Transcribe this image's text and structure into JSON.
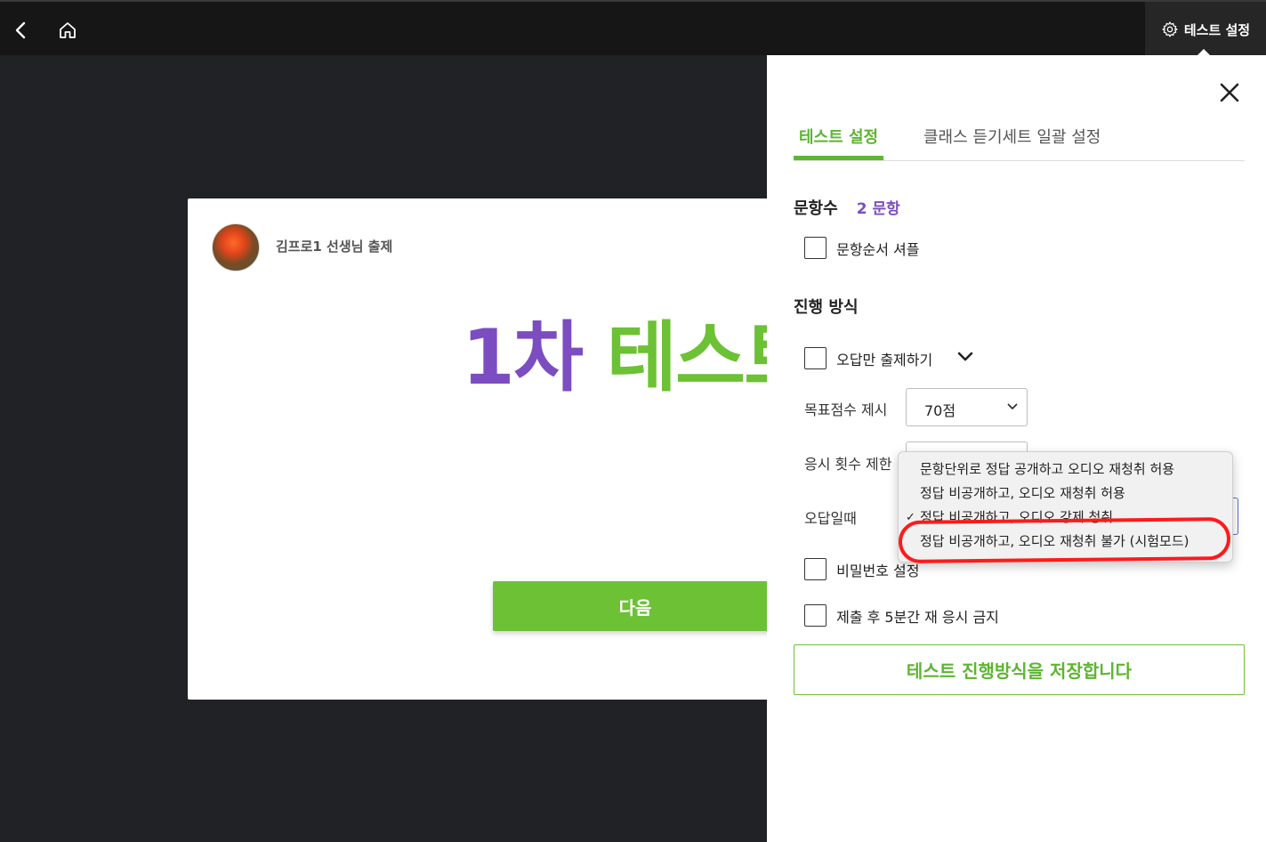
{
  "topbar": {
    "settings_label": "테스트 설정"
  },
  "card": {
    "author": "김프로1 선생님 출제",
    "title_number": "1차",
    "title_word": "테스트",
    "next_label": "다음"
  },
  "panel": {
    "tabs": [
      {
        "label": "테스트 설정"
      },
      {
        "label": "클래스 듣기세트 일괄 설정"
      }
    ],
    "question_count_label": "문항수",
    "question_count_value": "2 문항",
    "shuffle_label": "문항순서 셔플",
    "progress_title": "진행 방식",
    "wrong_only_label": "오답만 출제하기",
    "target_score_label": "목표점수 제시",
    "target_score_value": "70점",
    "attempt_limit_label": "응시 횟수 제한",
    "on_wrong_label": "오답일때",
    "password_label": "비밀번호 설정",
    "retake_ban_label": "제출 후 5분간 재 응시 금지",
    "save_label": "테스트 진행방식을 저장합니다"
  },
  "dropdown": {
    "options": [
      {
        "label": "문항단위로 정답 공개하고 오디오 재청취 허용"
      },
      {
        "label": "정답 비공개하고, 오디오 재청취 허용"
      },
      {
        "label": "정답 비공개하고, 오디오 강제 청취"
      },
      {
        "label": "정답 비공개하고, 오디오 재청취 불가 (시험모드)"
      }
    ],
    "selected_index": 2,
    "checkmark": "✓"
  },
  "colors": {
    "accent_green": "#6cc135",
    "accent_purple": "#7b4dc0",
    "annotation_red": "#ff1a1a"
  }
}
